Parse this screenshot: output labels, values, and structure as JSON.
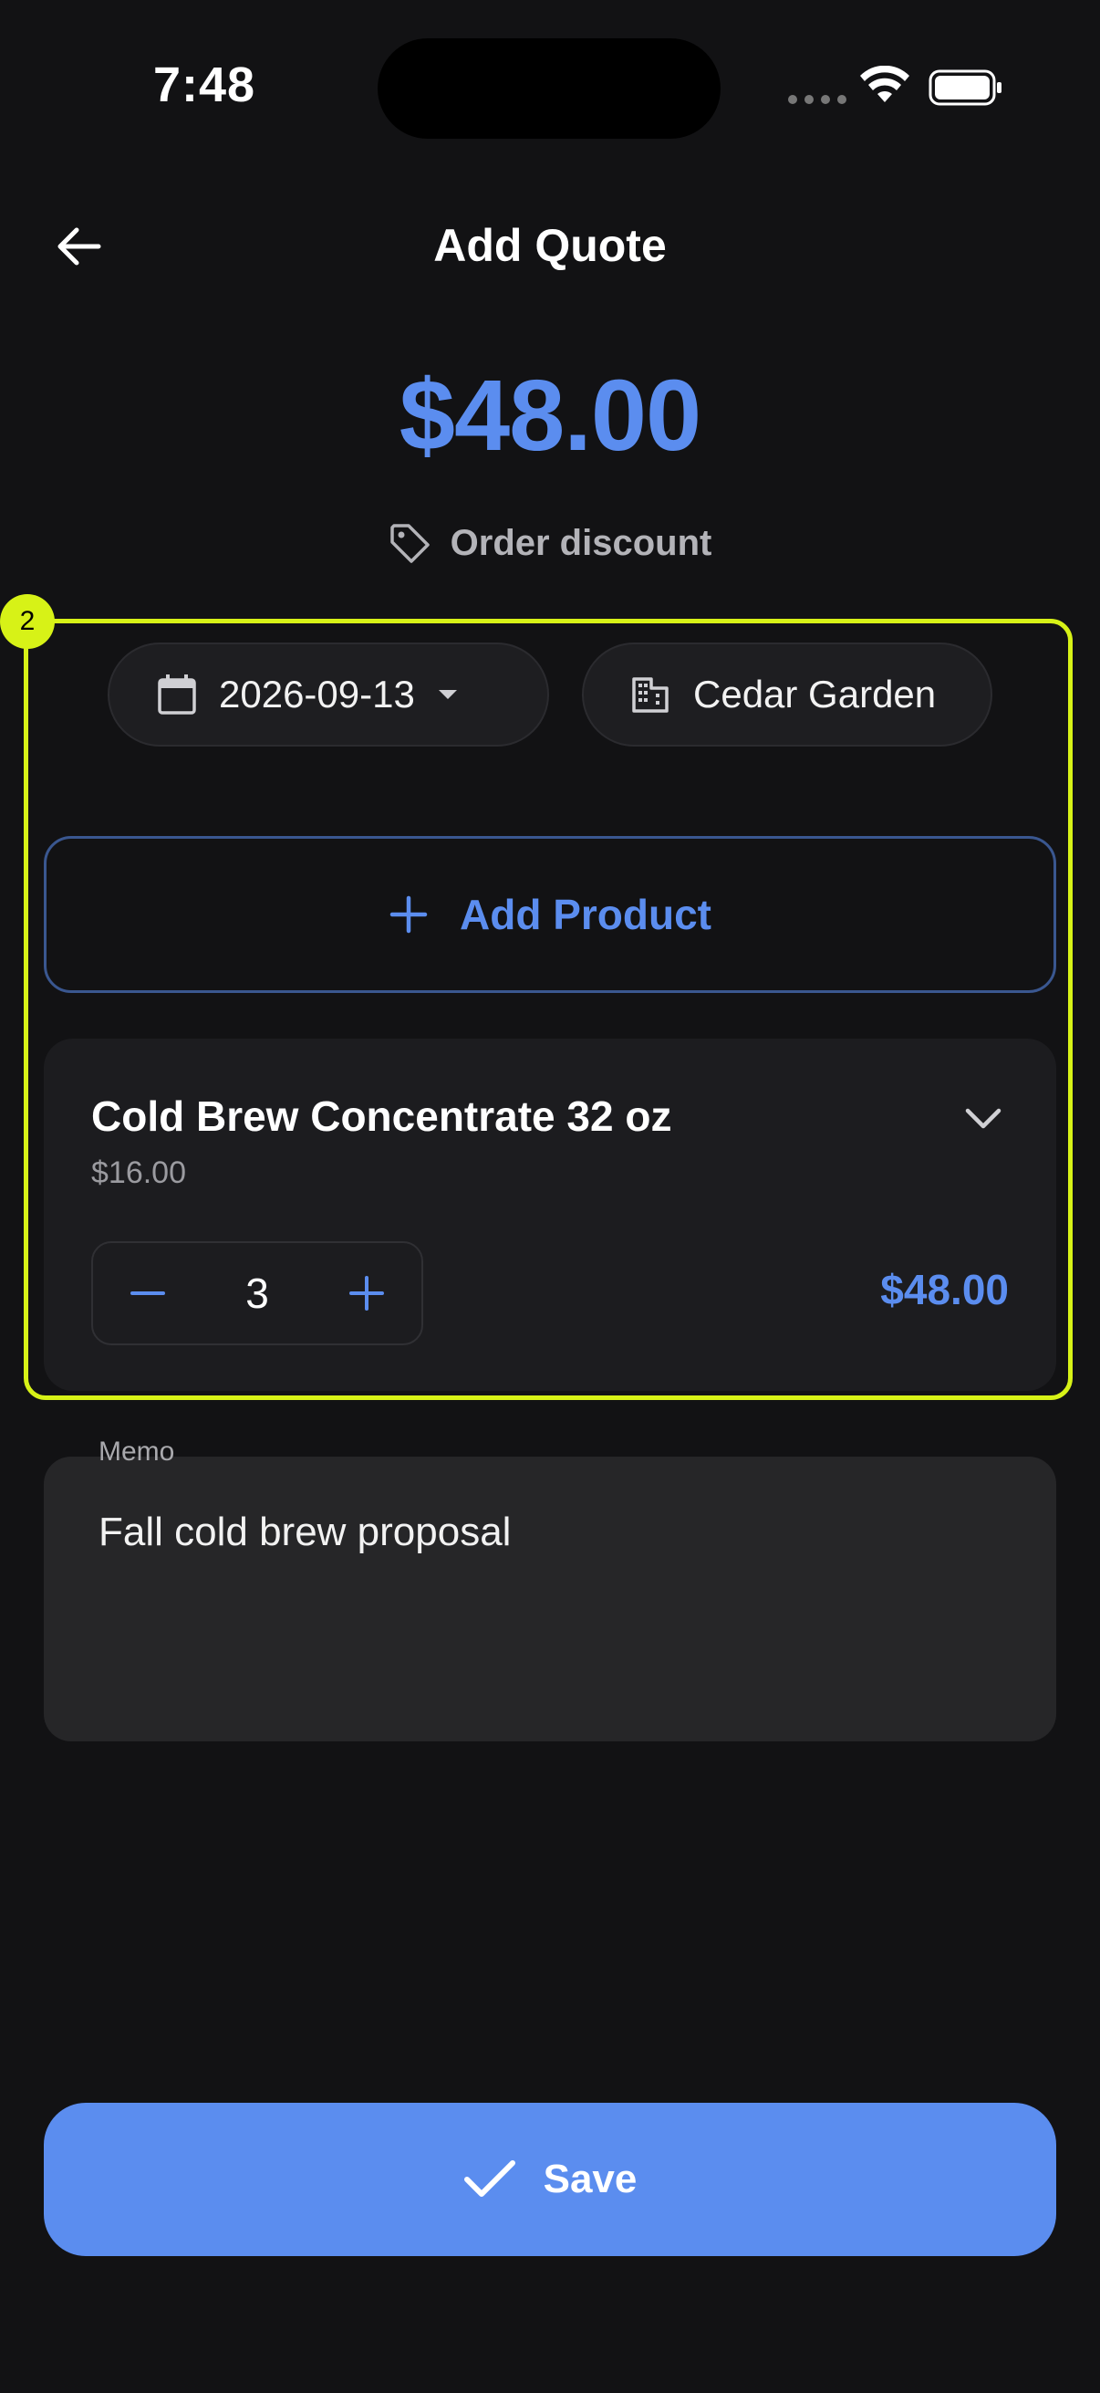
{
  "status_bar": {
    "time": "7:48"
  },
  "header": {
    "title": "Add Quote"
  },
  "total_amount": "$48.00",
  "order_discount_label": "Order discount",
  "highlight_badge": "2",
  "date_chip": {
    "value": "2026-09-13"
  },
  "supplier_chip": {
    "value": "Cedar Garden"
  },
  "add_product_label": "Add Product",
  "product": {
    "name": "Cold Brew Concentrate 32 oz",
    "unit_price": "$16.00",
    "quantity": "3",
    "line_total": "$48.00"
  },
  "memo": {
    "label": "Memo",
    "value": "Fall cold brew proposal"
  },
  "save_label": "Save",
  "colors": {
    "accent": "#5b8def",
    "background": "#121214",
    "card": "#1c1c1f",
    "highlight": "#d7f217"
  },
  "icons": [
    "arrow-left-icon",
    "tag-icon",
    "calendar-icon",
    "caret-down-icon",
    "building-icon",
    "plus-icon",
    "chevron-down-icon",
    "minus-icon",
    "check-icon",
    "wifi-icon",
    "battery-icon"
  ]
}
